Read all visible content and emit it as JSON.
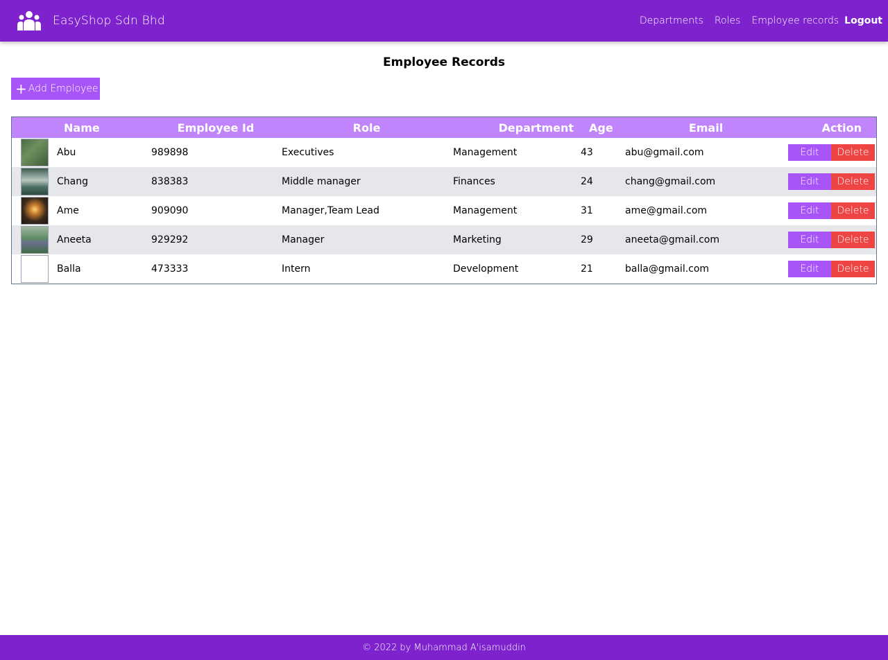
{
  "navbar": {
    "brand_name": "EasyShop Sdn Bhd",
    "links": [
      "Departments",
      "Roles",
      "Employee records"
    ],
    "logout_label": "Logout"
  },
  "page_title": "Employee Records",
  "add_button_label": "Add Employee",
  "table": {
    "headers": [
      "",
      "Name",
      "Employee Id",
      "Role",
      "Department",
      "Age",
      "Email",
      "Action"
    ],
    "rows": [
      {
        "name": "Abu",
        "employee_id": "989898",
        "role": "Executives",
        "department": "Management",
        "age": "43",
        "email": "abu@gmail.com"
      },
      {
        "name": "Chang",
        "employee_id": "838383",
        "role": "Middle manager",
        "department": "Finances",
        "age": "24",
        "email": "chang@gmail.com"
      },
      {
        "name": "Ame",
        "employee_id": "909090",
        "role": "Manager,Team Lead",
        "department": "Management",
        "age": "31",
        "email": "ame@gmail.com"
      },
      {
        "name": "Aneeta",
        "employee_id": "929292",
        "role": "Manager",
        "department": "Marketing",
        "age": "29",
        "email": "aneeta@gmail.com"
      },
      {
        "name": "Balla",
        "employee_id": "473333",
        "role": "Intern",
        "department": "Development",
        "age": "21",
        "email": "balla@gmail.com"
      }
    ],
    "edit_label": "Edit",
    "delete_label": "Delete"
  },
  "footer_text": "© 2022 by Muhammad A'isamuddin",
  "colors": {
    "navbar": "#7e22ce",
    "header_row": "#c084fc",
    "accent": "#a855f7",
    "danger": "#ef4444",
    "alt_row": "#e5e7eb"
  }
}
